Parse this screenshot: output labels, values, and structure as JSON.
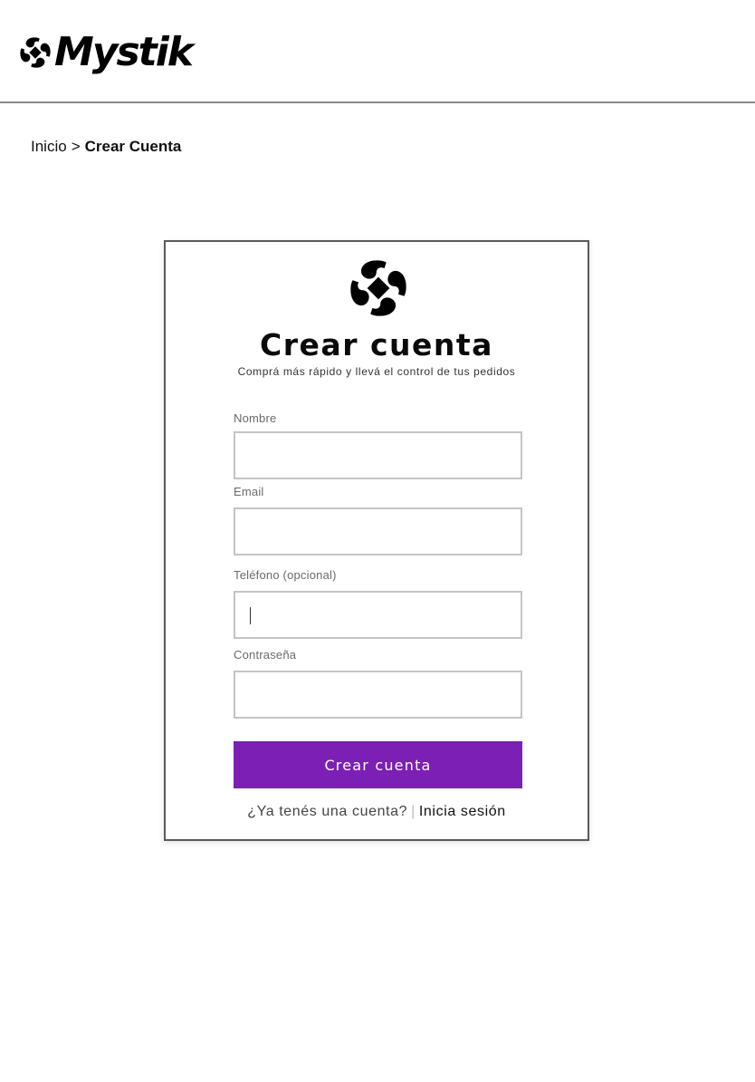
{
  "header": {
    "brand_name": "Mystik"
  },
  "breadcrumb": {
    "home": "Inicio",
    "separator": ">",
    "current": "Crear Cuenta"
  },
  "form": {
    "title": "Crear cuenta",
    "subtitle": "Comprá más rápido y llevá el control de tus pedidos",
    "fields": [
      {
        "label": "Nombre",
        "value": ""
      },
      {
        "label": "Email",
        "value": ""
      },
      {
        "label": "Teléfono (opcional)",
        "value": ""
      },
      {
        "label": "Contraseña",
        "value": ""
      }
    ],
    "submit_label": "Crear cuenta",
    "login_prompt": "¿Ya tenés una cuenta?",
    "login_separator": "|",
    "login_link": "Inicia sesión"
  },
  "colors": {
    "accent": "#7b1fb5",
    "header_border": "#8a8a8a",
    "input_border": "#c4c4c4"
  },
  "icons": {
    "brand_logo": "mystik-knot-icon"
  }
}
